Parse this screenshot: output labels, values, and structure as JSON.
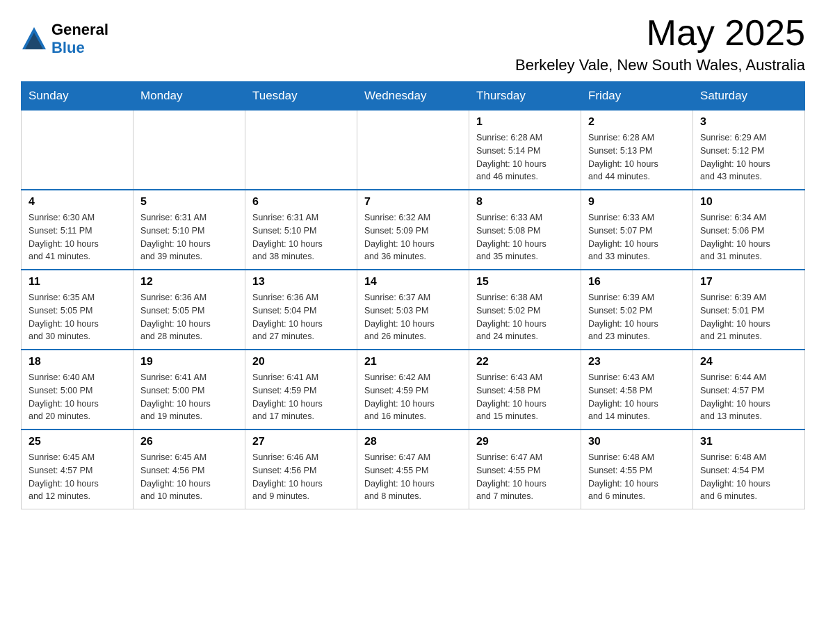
{
  "header": {
    "logo_text_general": "General",
    "logo_text_blue": "Blue",
    "month_title": "May 2025",
    "location": "Berkeley Vale, New South Wales, Australia"
  },
  "calendar": {
    "days_of_week": [
      "Sunday",
      "Monday",
      "Tuesday",
      "Wednesday",
      "Thursday",
      "Friday",
      "Saturday"
    ],
    "weeks": [
      [
        {
          "day": "",
          "info": ""
        },
        {
          "day": "",
          "info": ""
        },
        {
          "day": "",
          "info": ""
        },
        {
          "day": "",
          "info": ""
        },
        {
          "day": "1",
          "info": "Sunrise: 6:28 AM\nSunset: 5:14 PM\nDaylight: 10 hours\nand 46 minutes."
        },
        {
          "day": "2",
          "info": "Sunrise: 6:28 AM\nSunset: 5:13 PM\nDaylight: 10 hours\nand 44 minutes."
        },
        {
          "day": "3",
          "info": "Sunrise: 6:29 AM\nSunset: 5:12 PM\nDaylight: 10 hours\nand 43 minutes."
        }
      ],
      [
        {
          "day": "4",
          "info": "Sunrise: 6:30 AM\nSunset: 5:11 PM\nDaylight: 10 hours\nand 41 minutes."
        },
        {
          "day": "5",
          "info": "Sunrise: 6:31 AM\nSunset: 5:10 PM\nDaylight: 10 hours\nand 39 minutes."
        },
        {
          "day": "6",
          "info": "Sunrise: 6:31 AM\nSunset: 5:10 PM\nDaylight: 10 hours\nand 38 minutes."
        },
        {
          "day": "7",
          "info": "Sunrise: 6:32 AM\nSunset: 5:09 PM\nDaylight: 10 hours\nand 36 minutes."
        },
        {
          "day": "8",
          "info": "Sunrise: 6:33 AM\nSunset: 5:08 PM\nDaylight: 10 hours\nand 35 minutes."
        },
        {
          "day": "9",
          "info": "Sunrise: 6:33 AM\nSunset: 5:07 PM\nDaylight: 10 hours\nand 33 minutes."
        },
        {
          "day": "10",
          "info": "Sunrise: 6:34 AM\nSunset: 5:06 PM\nDaylight: 10 hours\nand 31 minutes."
        }
      ],
      [
        {
          "day": "11",
          "info": "Sunrise: 6:35 AM\nSunset: 5:05 PM\nDaylight: 10 hours\nand 30 minutes."
        },
        {
          "day": "12",
          "info": "Sunrise: 6:36 AM\nSunset: 5:05 PM\nDaylight: 10 hours\nand 28 minutes."
        },
        {
          "day": "13",
          "info": "Sunrise: 6:36 AM\nSunset: 5:04 PM\nDaylight: 10 hours\nand 27 minutes."
        },
        {
          "day": "14",
          "info": "Sunrise: 6:37 AM\nSunset: 5:03 PM\nDaylight: 10 hours\nand 26 minutes."
        },
        {
          "day": "15",
          "info": "Sunrise: 6:38 AM\nSunset: 5:02 PM\nDaylight: 10 hours\nand 24 minutes."
        },
        {
          "day": "16",
          "info": "Sunrise: 6:39 AM\nSunset: 5:02 PM\nDaylight: 10 hours\nand 23 minutes."
        },
        {
          "day": "17",
          "info": "Sunrise: 6:39 AM\nSunset: 5:01 PM\nDaylight: 10 hours\nand 21 minutes."
        }
      ],
      [
        {
          "day": "18",
          "info": "Sunrise: 6:40 AM\nSunset: 5:00 PM\nDaylight: 10 hours\nand 20 minutes."
        },
        {
          "day": "19",
          "info": "Sunrise: 6:41 AM\nSunset: 5:00 PM\nDaylight: 10 hours\nand 19 minutes."
        },
        {
          "day": "20",
          "info": "Sunrise: 6:41 AM\nSunset: 4:59 PM\nDaylight: 10 hours\nand 17 minutes."
        },
        {
          "day": "21",
          "info": "Sunrise: 6:42 AM\nSunset: 4:59 PM\nDaylight: 10 hours\nand 16 minutes."
        },
        {
          "day": "22",
          "info": "Sunrise: 6:43 AM\nSunset: 4:58 PM\nDaylight: 10 hours\nand 15 minutes."
        },
        {
          "day": "23",
          "info": "Sunrise: 6:43 AM\nSunset: 4:58 PM\nDaylight: 10 hours\nand 14 minutes."
        },
        {
          "day": "24",
          "info": "Sunrise: 6:44 AM\nSunset: 4:57 PM\nDaylight: 10 hours\nand 13 minutes."
        }
      ],
      [
        {
          "day": "25",
          "info": "Sunrise: 6:45 AM\nSunset: 4:57 PM\nDaylight: 10 hours\nand 12 minutes."
        },
        {
          "day": "26",
          "info": "Sunrise: 6:45 AM\nSunset: 4:56 PM\nDaylight: 10 hours\nand 10 minutes."
        },
        {
          "day": "27",
          "info": "Sunrise: 6:46 AM\nSunset: 4:56 PM\nDaylight: 10 hours\nand 9 minutes."
        },
        {
          "day": "28",
          "info": "Sunrise: 6:47 AM\nSunset: 4:55 PM\nDaylight: 10 hours\nand 8 minutes."
        },
        {
          "day": "29",
          "info": "Sunrise: 6:47 AM\nSunset: 4:55 PM\nDaylight: 10 hours\nand 7 minutes."
        },
        {
          "day": "30",
          "info": "Sunrise: 6:48 AM\nSunset: 4:55 PM\nDaylight: 10 hours\nand 6 minutes."
        },
        {
          "day": "31",
          "info": "Sunrise: 6:48 AM\nSunset: 4:54 PM\nDaylight: 10 hours\nand 6 minutes."
        }
      ]
    ]
  }
}
